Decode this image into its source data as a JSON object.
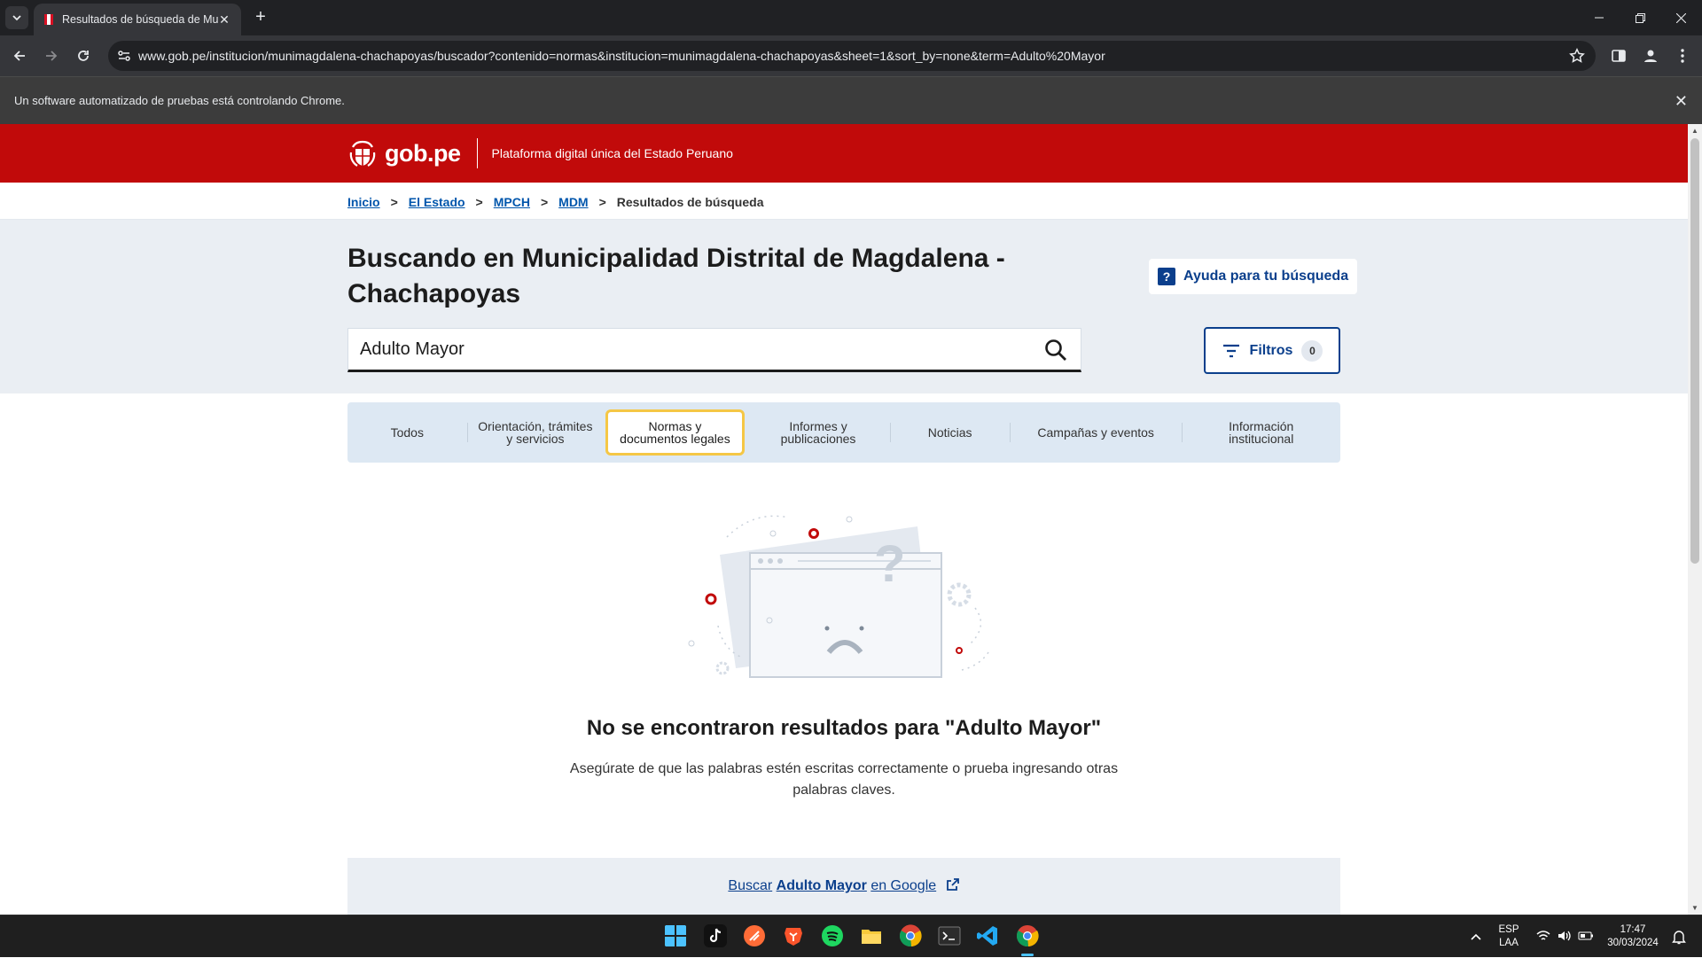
{
  "browser": {
    "tab_title": "Resultados de búsqueda de Municipalidad",
    "url": "www.gob.pe/institucion/munimagdalena-chachapoyas/buscador?contenido=normas&institucion=munimagdalena-chachapoyas&sheet=1&sort_by=none&term=Adulto%20Mayor",
    "infobar_text": "Un software automatizado de pruebas está controlando Chrome."
  },
  "header": {
    "logo_text": "gob.pe",
    "tagline": "Plataforma digital única del Estado Peruano",
    "brand_color": "#c10a0a"
  },
  "breadcrumb": {
    "items": [
      "Inicio",
      "El Estado",
      "MPCH",
      "MDM"
    ],
    "current": "Resultados de búsqueda"
  },
  "hero": {
    "title": "Buscando en Municipalidad Distrital de Magdalena - Chachapoyas",
    "help_label": "Ayuda para tu búsqueda",
    "search_value": "Adulto Mayor",
    "filters_label": "Filtros",
    "filters_count": "0"
  },
  "content_tabs": [
    {
      "label": "Todos"
    },
    {
      "label": "Orientación, trámites y servicios"
    },
    {
      "label": "Normas y documentos legales",
      "active": true
    },
    {
      "label": "Informes y publicaciones"
    },
    {
      "label": "Noticias"
    },
    {
      "label": "Campañas y eventos"
    },
    {
      "label": "Información institucional"
    }
  ],
  "results": {
    "empty_title": "No se encontraron resultados para \"Adulto Mayor\"",
    "empty_hint": "Asegúrate de que las palabras estén escritas correctamente o prueba ingresando otras palabras claves.",
    "google_prefix": "Buscar",
    "google_term": "Adulto Mayor",
    "google_suffix": "en Google"
  },
  "taskbar": {
    "lang_top": "ESP",
    "lang_bottom": "LAA",
    "time": "17:47",
    "date": "30/03/2024"
  }
}
